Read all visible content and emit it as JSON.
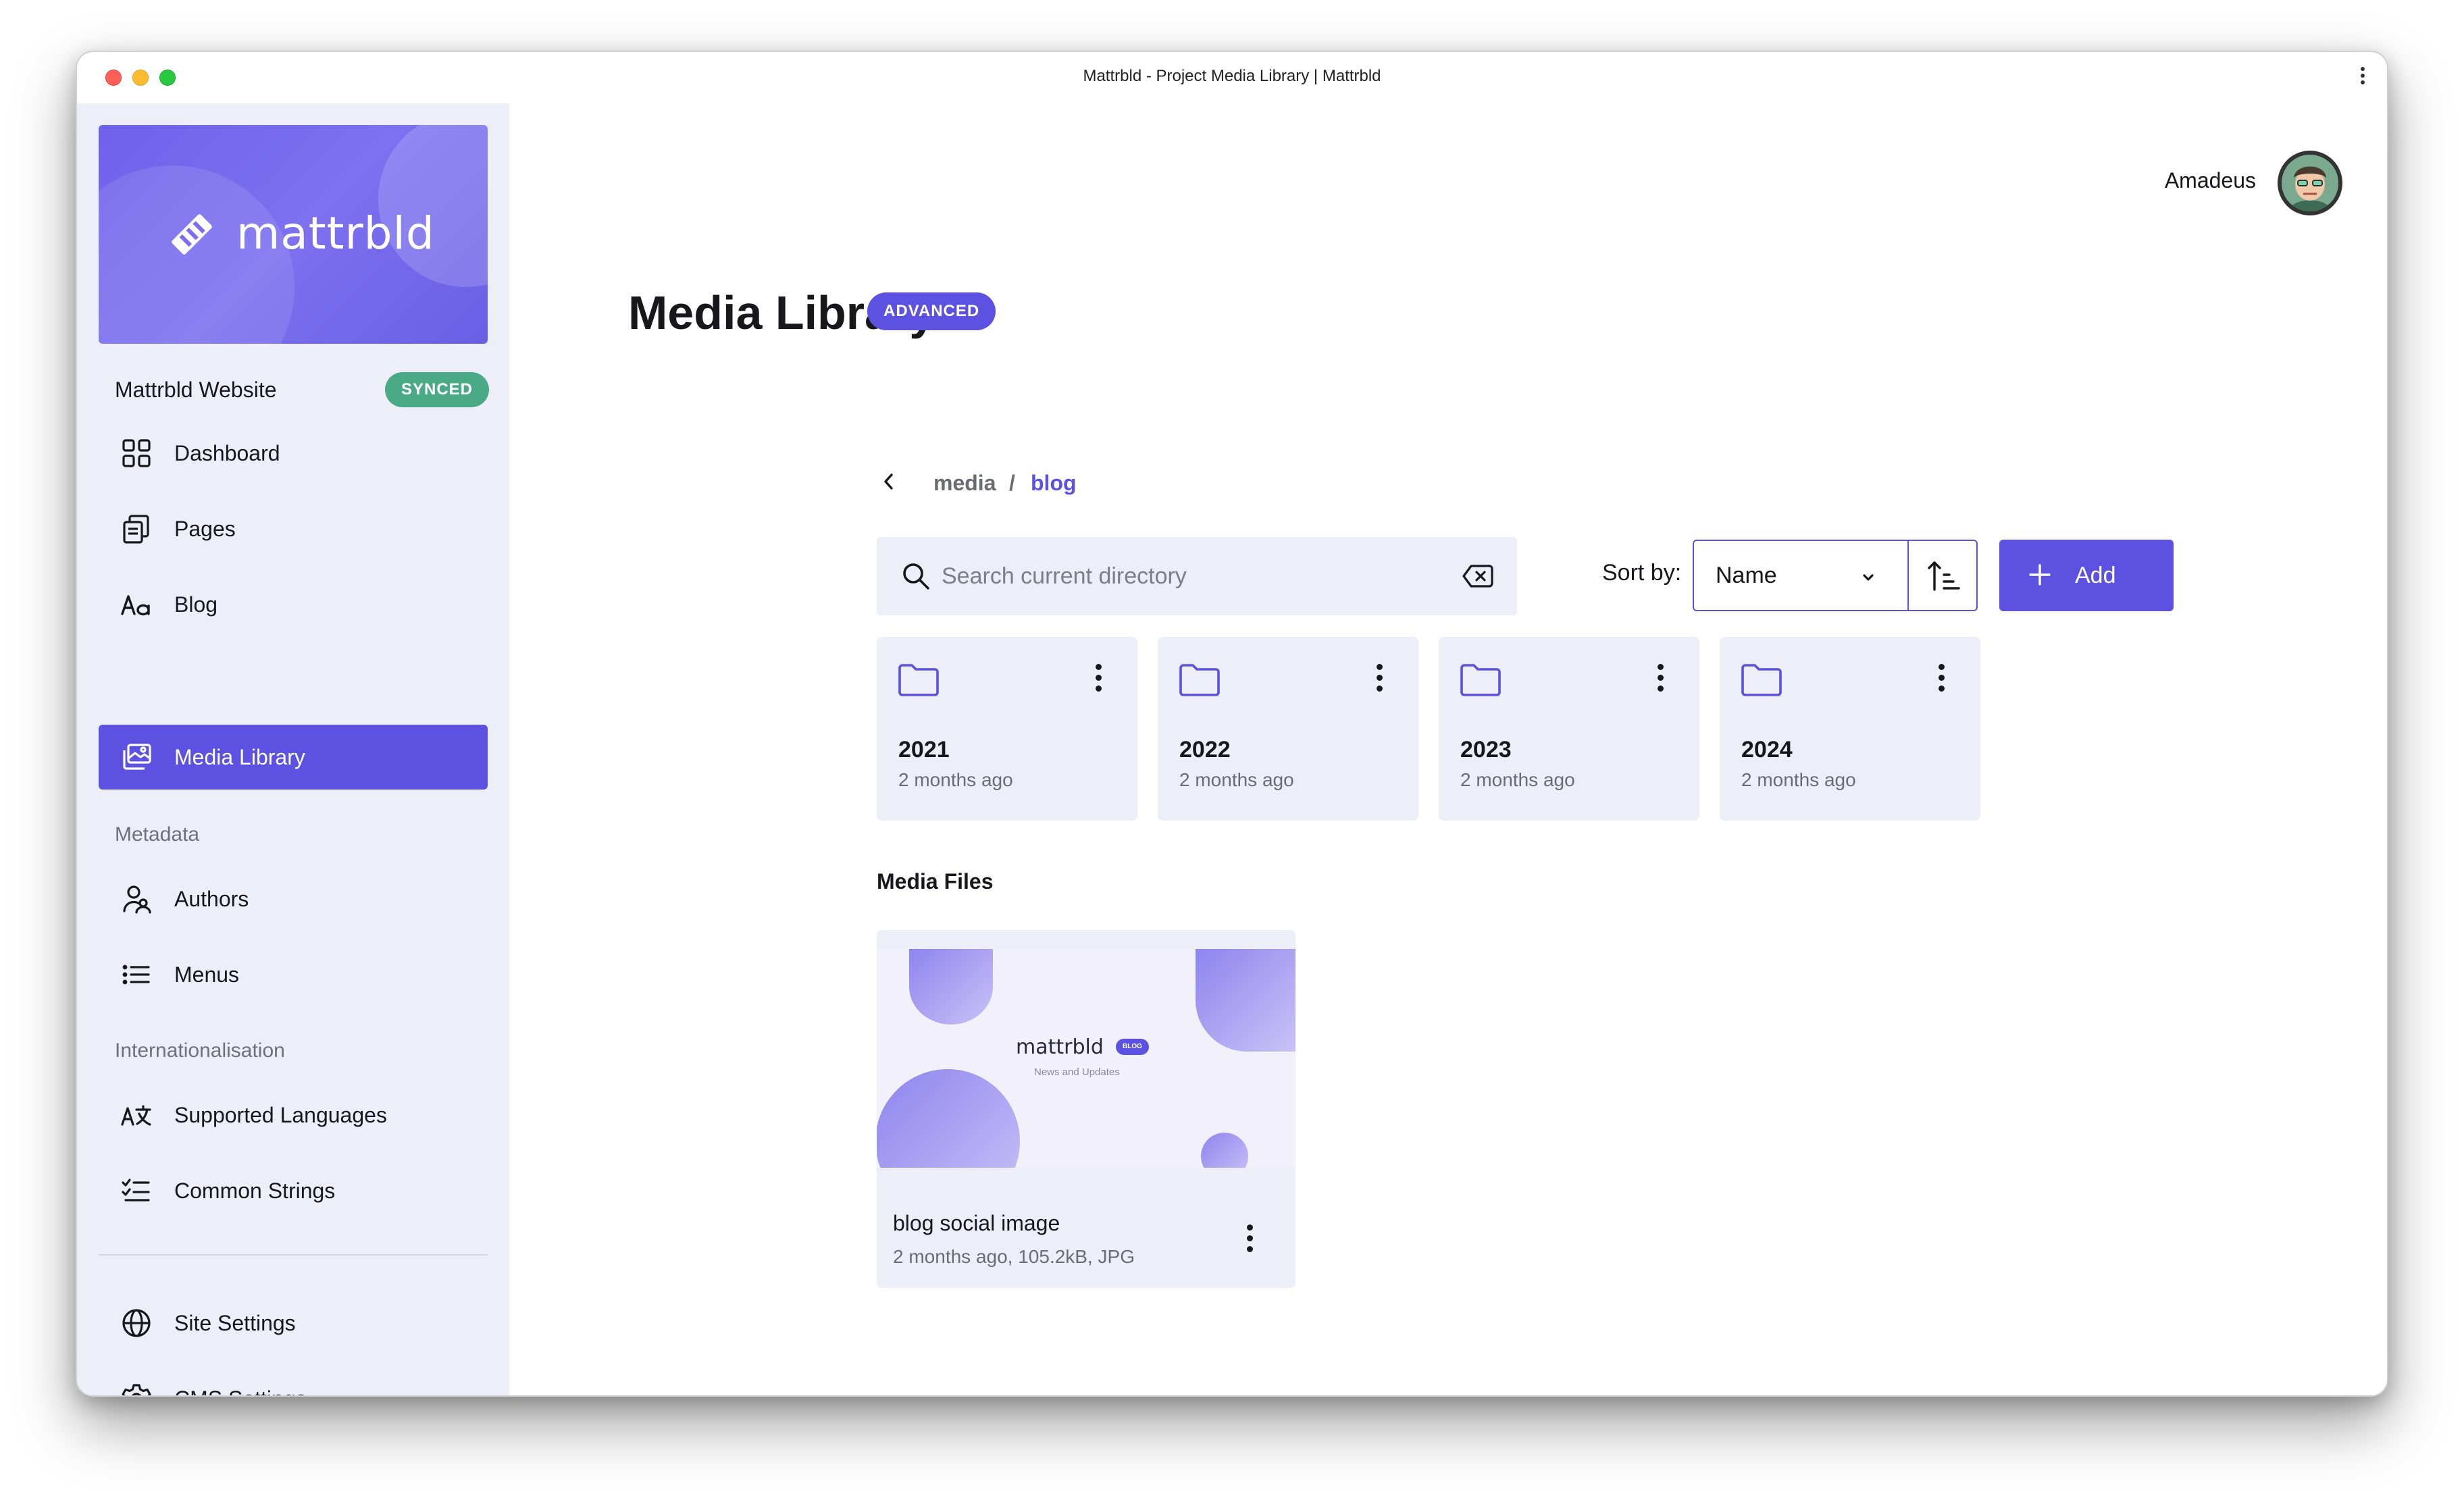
{
  "window": {
    "title": "Mattrbld - Project Media Library | Mattrbld"
  },
  "brand": {
    "logo_text": "mattrbld",
    "project_name": "Mattrbld Website",
    "sync_status": "SYNCED"
  },
  "sidebar": {
    "nav": [
      {
        "label": "Dashboard",
        "icon": "grid-icon"
      },
      {
        "label": "Pages",
        "icon": "pages-icon"
      },
      {
        "label": "Blog",
        "icon": "text-aa-icon"
      },
      {
        "label": "Media Library",
        "icon": "images-icon",
        "active": true
      }
    ],
    "metadata_label": "Metadata",
    "metadata": [
      {
        "label": "Authors",
        "icon": "users-icon"
      },
      {
        "label": "Menus",
        "icon": "list-icon"
      }
    ],
    "i18n_label": "Internationalisation",
    "i18n": [
      {
        "label": "Supported Languages",
        "icon": "translate-icon"
      },
      {
        "label": "Common Strings",
        "icon": "checklist-icon"
      }
    ],
    "settings": [
      {
        "label": "Site Settings",
        "icon": "globe-icon"
      },
      {
        "label": "CMS Settings",
        "icon": "gear-icon"
      }
    ]
  },
  "user": {
    "name": "Amadeus"
  },
  "page": {
    "title": "Media Library",
    "badge": "ADVANCED"
  },
  "breadcrumb": {
    "items": [
      "media",
      "blog"
    ],
    "separator": "/"
  },
  "search": {
    "placeholder": "Search current directory",
    "value": ""
  },
  "sort": {
    "label": "Sort by:",
    "value": "Name"
  },
  "add_button": {
    "label": "Add"
  },
  "folders": [
    {
      "name": "2021",
      "modified": "2 months ago"
    },
    {
      "name": "2022",
      "modified": "2 months ago"
    },
    {
      "name": "2023",
      "modified": "2 months ago"
    },
    {
      "name": "2024",
      "modified": "2 months ago"
    }
  ],
  "media_files": {
    "title": "Media Files",
    "items": [
      {
        "name": "blog social image",
        "meta": "2 months ago, 105.2kB, JPG",
        "thumb_logo": "mattrbld",
        "thumb_badge": "BLOG",
        "thumb_subtitle": "News and Updates"
      }
    ]
  },
  "colors": {
    "accent": "#5c51e0",
    "sidebar_bg": "#eeeef9",
    "synced": "#4aaa88"
  }
}
